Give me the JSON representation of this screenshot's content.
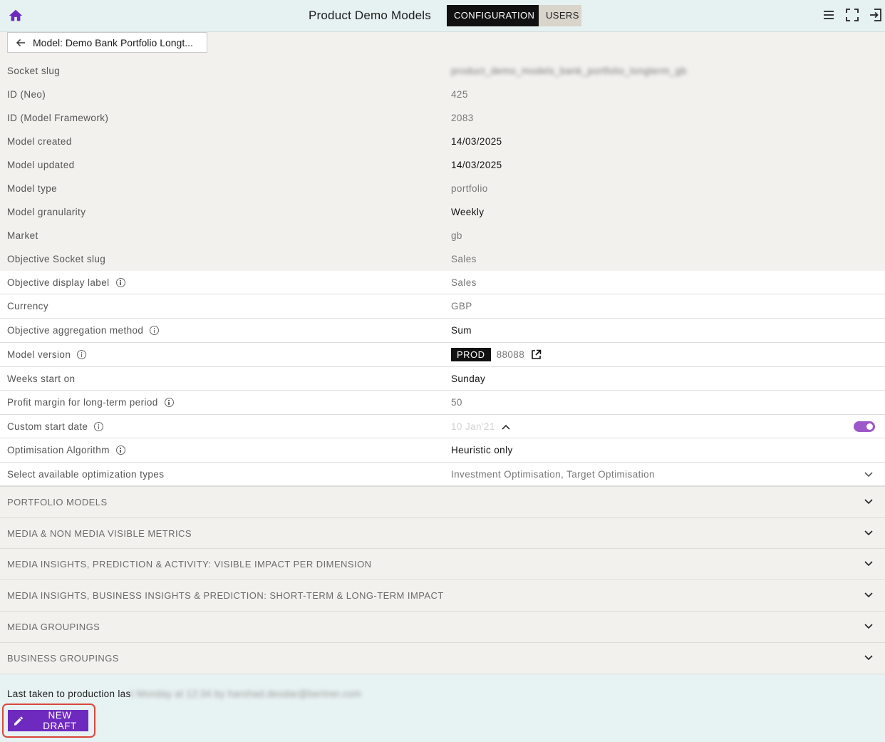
{
  "header": {
    "title": "Product Demo Models",
    "tabs": [
      {
        "label": "CONFIGURATION",
        "active": true
      },
      {
        "label": "USERS",
        "active": false
      }
    ],
    "icons": [
      "home-icon",
      "menu-icon",
      "fullscreen-icon",
      "logout-icon"
    ]
  },
  "back_button": {
    "label": "Model: Demo Bank Portfolio Longt..."
  },
  "details": [
    {
      "label": "Socket slug",
      "value": "product_demo_models_bank_portfolio_longterm_gb",
      "blurred": true
    },
    {
      "label": "ID (Neo)",
      "value": "425"
    },
    {
      "label": "ID (Model Framework)",
      "value": "2083"
    },
    {
      "label": "Model created",
      "value": "14/03/2025"
    },
    {
      "label": "Model updated",
      "value": "14/03/2025"
    },
    {
      "label": "Model type",
      "value": "portfolio"
    },
    {
      "label": "Model granularity",
      "value": "Weekly"
    },
    {
      "label": "Market",
      "value": "gb"
    },
    {
      "label": "Objective Socket slug",
      "value": "Sales"
    }
  ],
  "settings": {
    "objective_display_label": {
      "label": "Objective display label",
      "value": "Sales"
    },
    "currency": {
      "label": "Currency",
      "value": "GBP"
    },
    "objective_aggregation_method": {
      "label": "Objective aggregation method",
      "value": "Sum"
    },
    "model_version": {
      "label": "Model version",
      "badge": "PROD",
      "value": "88088"
    },
    "weeks_start_on": {
      "label": "Weeks start on",
      "value": "Sunday"
    },
    "profit_margin": {
      "label": "Profit margin for long-term period",
      "value": "50"
    },
    "custom_start_date": {
      "label": "Custom start date",
      "value": "10 Jan'21",
      "enabled": true
    },
    "optimisation_algorithm": {
      "label": "Optimisation Algorithm",
      "value": "Heuristic only"
    },
    "optimization_types": {
      "label": "Select available optimization types",
      "value": "Investment Optimisation, Target Optimisation"
    }
  },
  "sections": [
    "PORTFOLIO MODELS",
    "MEDIA & NON MEDIA VISIBLE METRICS",
    "MEDIA INSIGHTS, PREDICTION & ACTIVITY: VISIBLE IMPACT PER DIMENSION",
    "MEDIA INSIGHTS, BUSINESS INSIGHTS & PREDICTION: SHORT-TERM & LONG-TERM IMPACT",
    "MEDIA GROUPINGS",
    "BUSINESS GROUPINGS"
  ],
  "footer": {
    "last_taken_prefix": "Last taken to production las",
    "last_taken_blurred": "t Monday at 12:34 by harshad.deodar@bertner.com",
    "new_draft_label": "NEW DRAFT"
  },
  "colors": {
    "accent": "#6e2abf",
    "toggle": "#9c58c9",
    "highlight": "#d9473c",
    "topbar": "#e6f1f1"
  }
}
